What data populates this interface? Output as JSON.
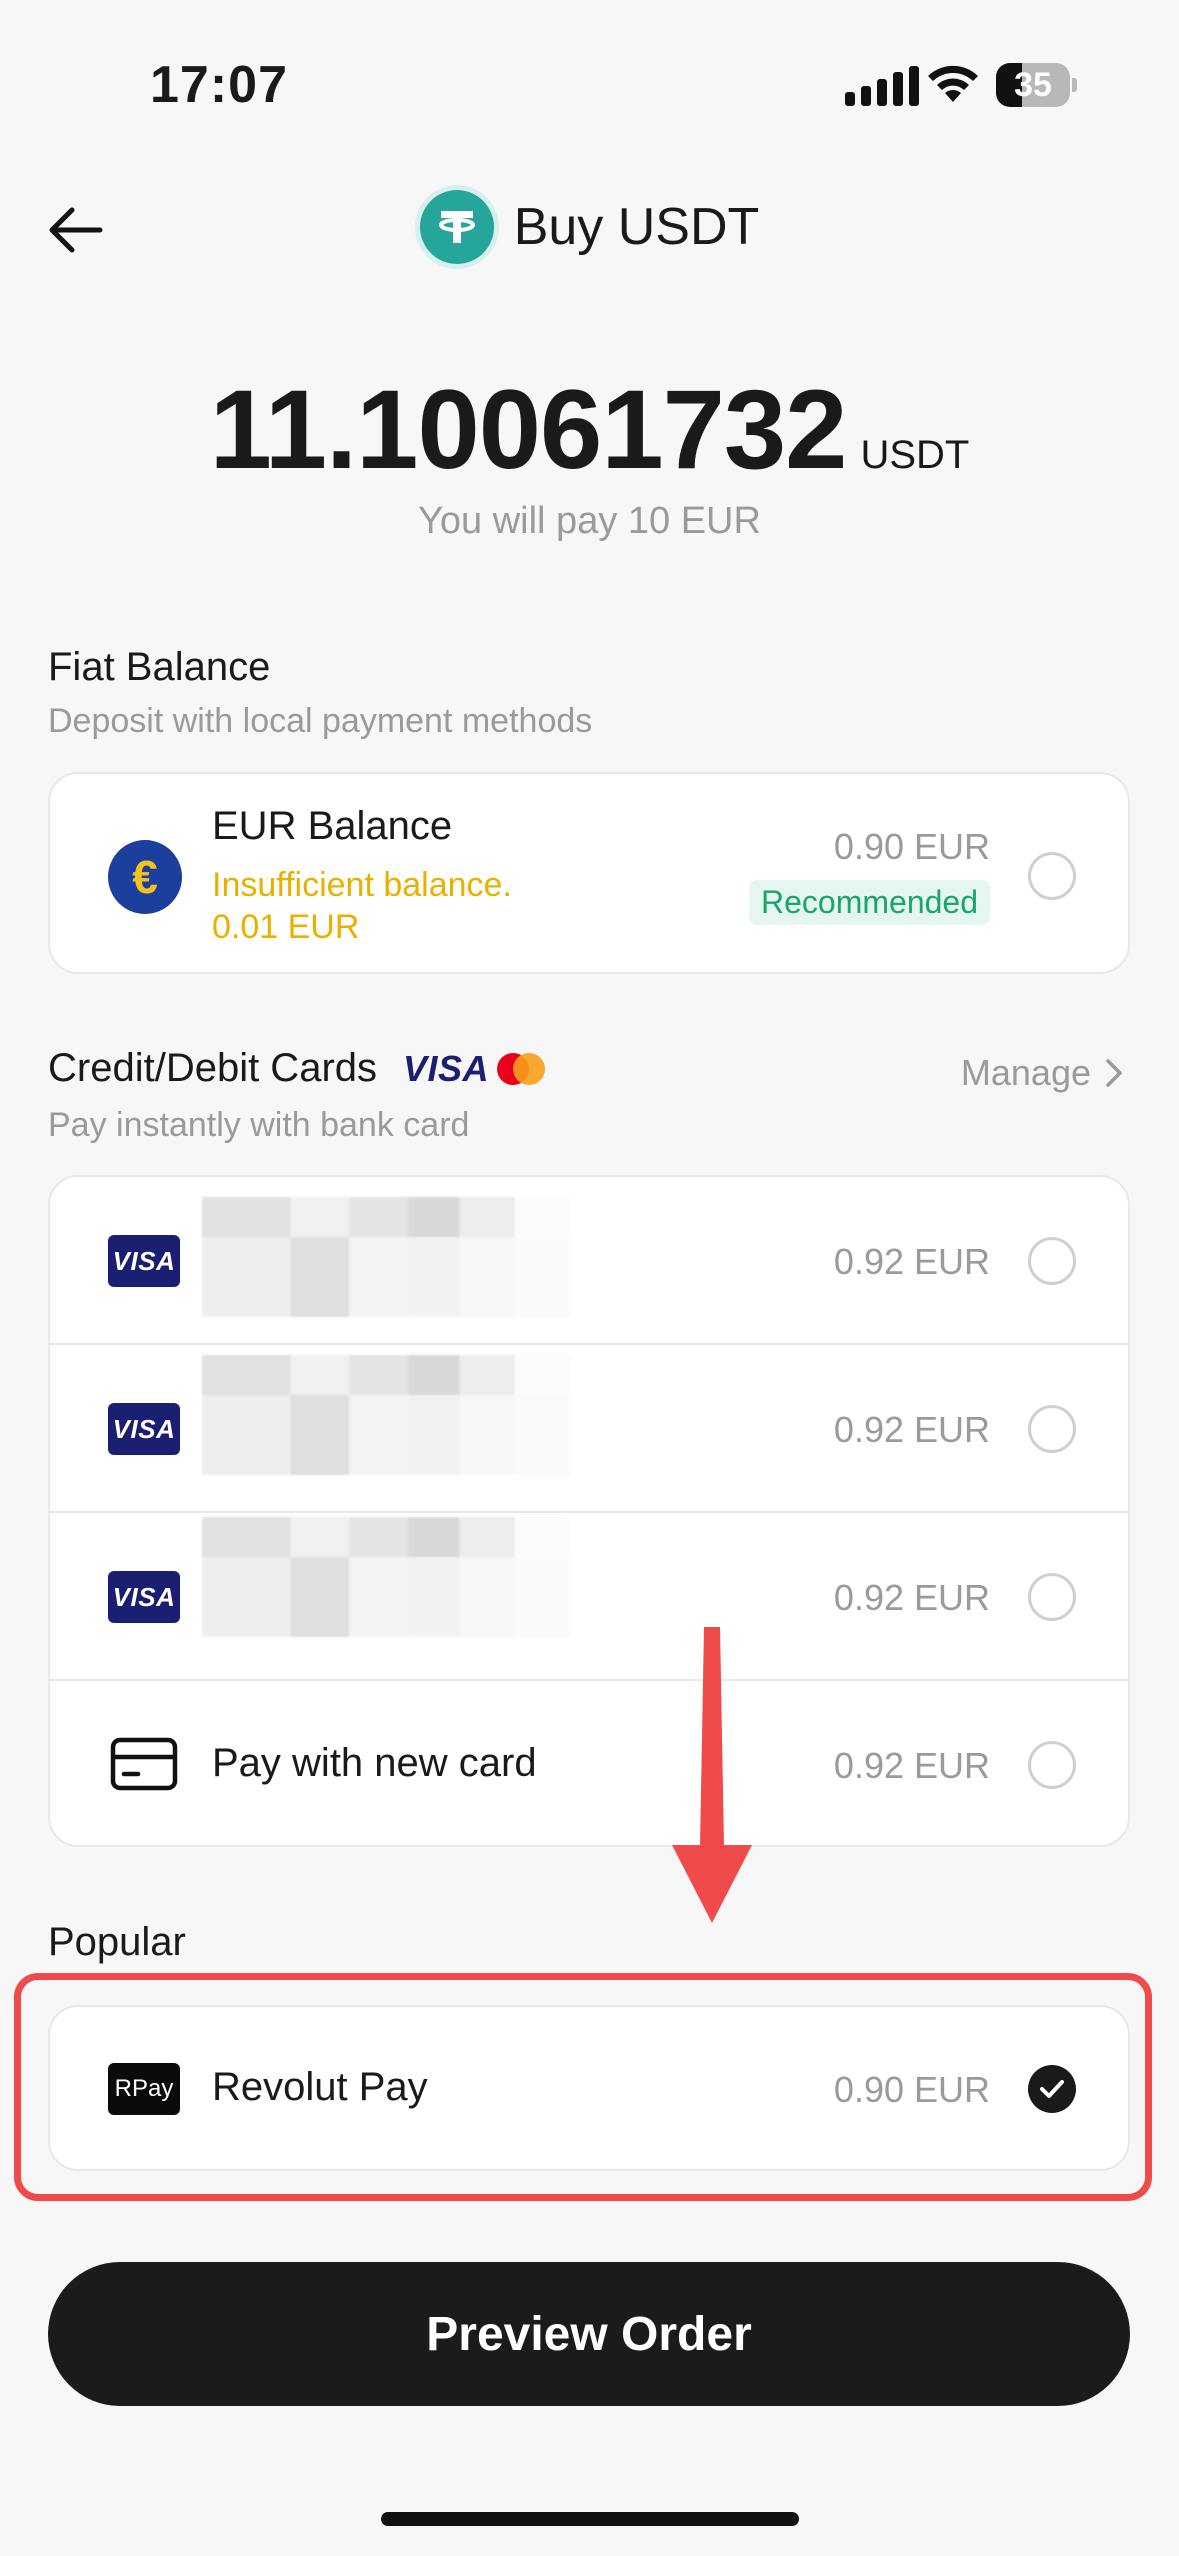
{
  "status_bar": {
    "time": "17:07",
    "battery": "35"
  },
  "header": {
    "title": "Buy USDT"
  },
  "amount": {
    "value": "11.10061732",
    "unit": "USDT",
    "note": "You will pay 10 EUR"
  },
  "fiat": {
    "title": "Fiat Balance",
    "subtitle": "Deposit with local payment methods",
    "eur": {
      "label": "EUR Balance",
      "warning_line1": "Insufficient balance.",
      "warning_line2": "0.01 EUR",
      "price": "0.90 EUR",
      "badge": "Recommended"
    }
  },
  "cards": {
    "title": "Credit/Debit Cards",
    "subtitle": "Pay instantly with bank card",
    "manage": "Manage",
    "visa_text": "VISA",
    "items": [
      {
        "brand": "VISA",
        "price": "0.92 EUR"
      },
      {
        "brand": "VISA",
        "price": "0.92 EUR"
      },
      {
        "brand": "VISA",
        "price": "0.92 EUR"
      }
    ],
    "new_card": {
      "label": "Pay with new card",
      "price": "0.92 EUR"
    }
  },
  "popular": {
    "title": "Popular",
    "revolut": {
      "logo": "RPay",
      "label": "Revolut Pay",
      "price": "0.90 EUR",
      "selected": true
    }
  },
  "button": {
    "label": "Preview Order"
  },
  "colors": {
    "accent_red": "#ef4b4b",
    "warning": "#e8b100",
    "recommended": "#1aa56b",
    "tether": "#26a69a",
    "visa": "#1a1f71"
  }
}
